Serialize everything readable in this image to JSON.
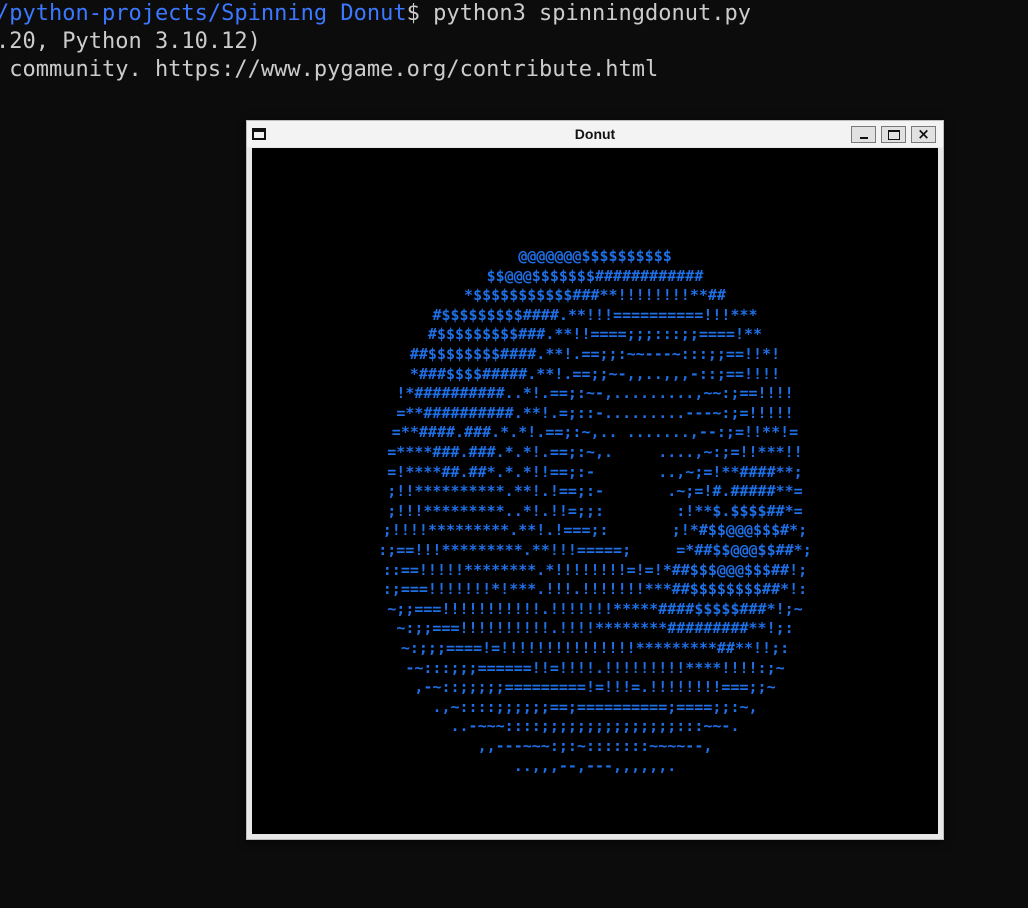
{
  "terminal": {
    "lines": [
      {
        "path": "/python-projects/Spinning Donut",
        "command": "$ python3 spinningdonut.py"
      },
      {
        "text": ".20, Python 3.10.12)"
      },
      {
        "text": " community. https://www.pygame.org/contribute.html"
      }
    ]
  },
  "window": {
    "title": "Donut",
    "buttons": {
      "minimize": "minimize",
      "maximize": "maximize",
      "close": "×"
    }
  },
  "donut": {
    "color": "#1f6fe6",
    "rows": [
      "@@@@@@@$$$$$$$$$$",
      "$$@@@$$$$$$$############",
      "*$$$$$$$$$$$###**!!!!!!!!**##",
      "#$$$$$$$$$####.**!!!==========!!!***",
      "#$$$$$$$$$###.**!!====;;;:::;;====!**",
      "##$$$$$$$$####.**!.==;;:~~---~:::;;==!!*!",
      "*###$$$$#####.**!.==;;~-,,..,,,-::;==!!!!",
      "!*##########..*!.==;:~-,.........,~~:;==!!!!",
      "=**##########.**!.=;::-.........---~:;=!!!!!",
      "=**####.###.*.*!.==;:~,.. .......,--:;=!!**!=",
      "=****###.###.*.*!.==;:~,.     ....,~:;=!!***!!",
      "=!****##.##*.*.*!!==;:-       ..,~;=!**####**;",
      ";!!**********.**!.!==;:-       .~;=!#.#####**=",
      ";!!!*********..*!.!!=;;:        :!**$.$$$$##*=",
      ";!!!!*********.**!.!===;:       ;!*#$$@@@$$$#*;",
      ":;==!!!*********.**!!!=====;     =*##$$@@@$$##*;",
      "::==!!!!!********.*!!!!!!!!=!=!*##$$$@@@$$$##!;",
      ":;===!!!!!!!*!***.!!!.!!!!!!!***##$$$$$$$$##*!:",
      "~;;===!!!!!!!!!!!.!!!!!!!*****####$$$$$###*!;~",
      "~:;;===!!!!!!!!!!.!!!!********#########**!;:",
      "~:;;;====!=!!!!!!!!!!!!!!!*********##**!!;:",
      "-~:::;;;======!!=!!!!.!!!!!!!!!****!!!!:;~",
      ",-~::;;;;;=========!=!!!=.!!!!!!!!===;;~",
      ".,~::::;;;;;;==;==========;====;;:~,",
      "..-~~~::::;;;;;;;;;;;;;;;:::~~-.",
      ",,---~~~:;:~:::::::~~~~--,",
      "..,,,--,---,,,,,,."
    ]
  }
}
